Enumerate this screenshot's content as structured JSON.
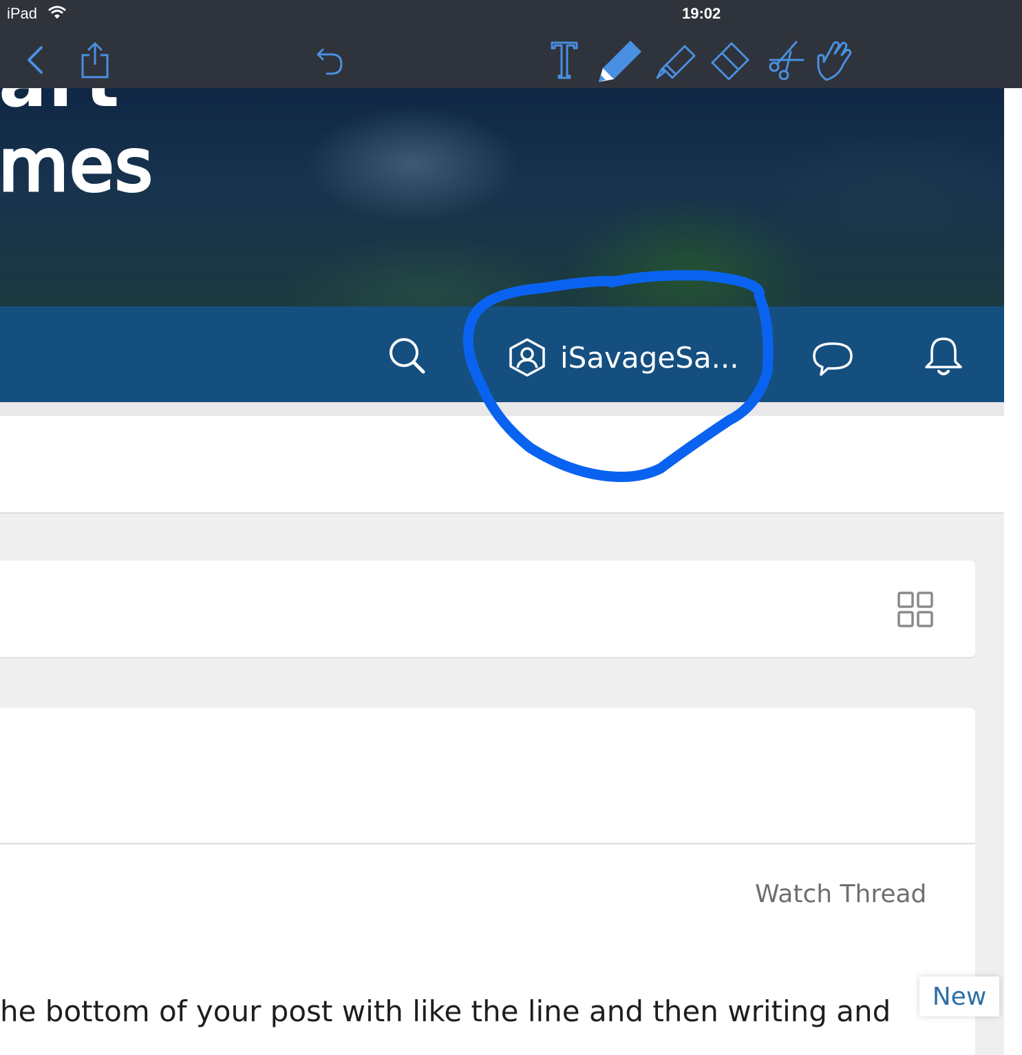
{
  "status_bar": {
    "device": "iPad",
    "time": "19:02"
  },
  "toolbar": {
    "icons": [
      "back-icon",
      "share-icon",
      "undo-icon",
      "text-tool-icon",
      "pen-tool-icon",
      "highlighter-tool-icon",
      "eraser-tool-icon",
      "lasso-scissors-icon",
      "touch-hand-icon"
    ],
    "accent_color": "#4a90e2",
    "selected_tool": "pen-tool-icon"
  },
  "hero": {
    "partial_word_top": "art",
    "partial_word_bottom": "mes"
  },
  "navbar": {
    "bg_color": "#154f80",
    "user_name": "iSavageSa..."
  },
  "thread": {
    "watch_label": "Watch Thread",
    "post_text": "he bottom of your post with like the line and then writing and",
    "new_badge": "New"
  },
  "annotation": {
    "color": "#0a63f0"
  }
}
